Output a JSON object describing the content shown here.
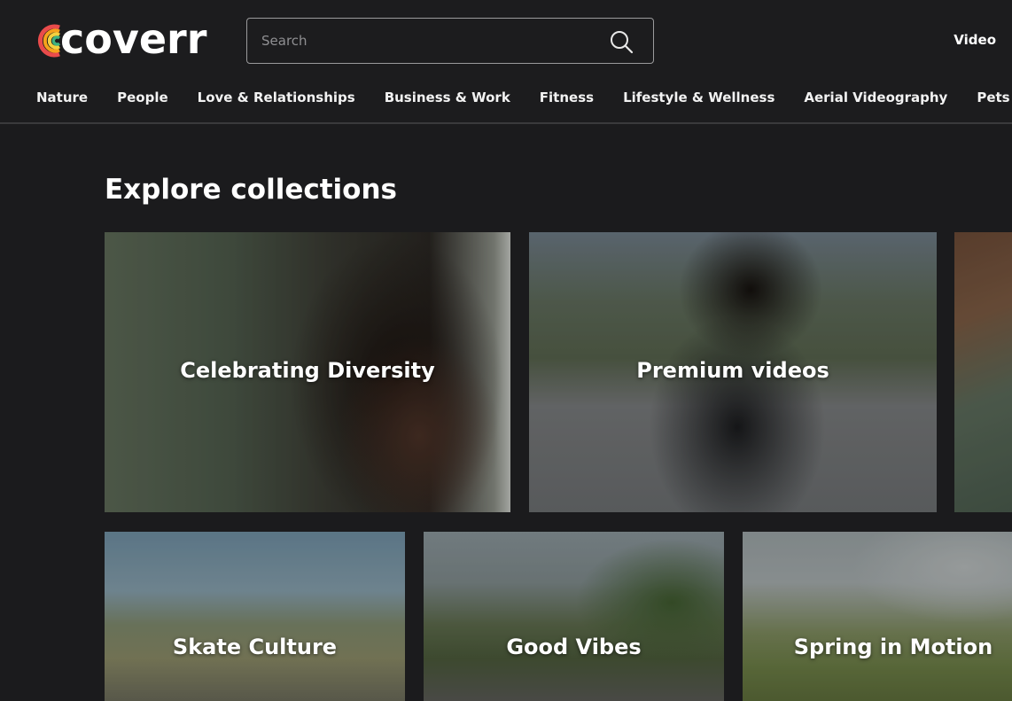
{
  "brand": {
    "name": "coverr",
    "logo_colors": [
      "#e94b4b",
      "#f7a21b",
      "#f4d03f",
      "#3fb27f",
      "#3b82f6"
    ]
  },
  "search": {
    "placeholder": "Search",
    "value": ""
  },
  "top_nav": {
    "video_label": "Video"
  },
  "categories": [
    "Nature",
    "People",
    "Love & Relationships",
    "Business & Work",
    "Fitness",
    "Lifestyle & Wellness",
    "Aerial Videography",
    "Pets & Animals"
  ],
  "main": {
    "section_title": "Explore collections",
    "collections": [
      "Celebrating Diversity",
      "Premium videos",
      "Skate Culture",
      "Good Vibes",
      "Spring in Motion"
    ]
  },
  "colors": {
    "background": "#1b1b1d",
    "text": "#ffffff",
    "border": "#9a9a9c"
  }
}
